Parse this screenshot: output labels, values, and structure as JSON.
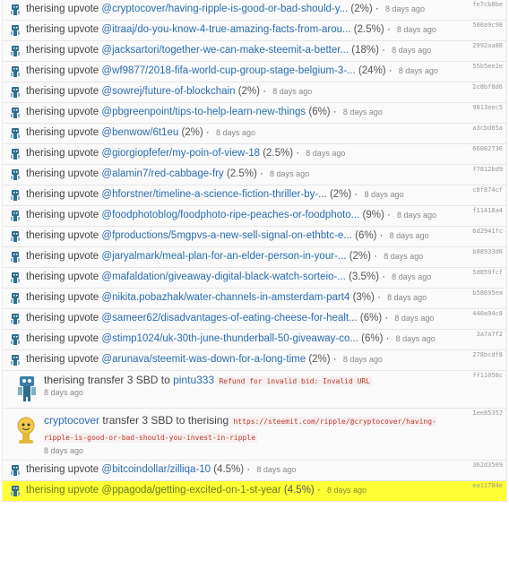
{
  "colors": {
    "link": "#2a6db0",
    "highlight": "#ffff33",
    "memo": "#c0392b",
    "avatar": "#2e6f8e"
  },
  "rows": [
    {
      "kind": "upvote",
      "user": "therising",
      "action": "upvote",
      "link": "@cryptocover/having-ripple-is-good-or-bad-should-y...",
      "pct": "(2%)",
      "time": "8 days ago",
      "hash": "fe7cb8be"
    },
    {
      "kind": "upvote",
      "user": "therising",
      "action": "upvote",
      "link": "@itraaj/do-you-know-4-true-amazing-facts-from-arou...",
      "pct": "(2.5%)",
      "time": "8 days ago",
      "hash": "500a9c98"
    },
    {
      "kind": "upvote",
      "user": "therising",
      "action": "upvote",
      "link": "@jacksartori/together-we-can-make-steemit-a-better...",
      "pct": "(18%)",
      "time": "8 days ago",
      "hash": "2992aa80"
    },
    {
      "kind": "upvote",
      "user": "therising",
      "action": "upvote",
      "link": "@wf9877/2018-fifa-world-cup-group-stage-belgium-3-...",
      "pct": "(24%)",
      "time": "8 days ago",
      "hash": "55b5ee2e"
    },
    {
      "kind": "upvote",
      "user": "therising",
      "action": "upvote",
      "link": "@sowrej/future-of-blockchain",
      "pct": "(2%)",
      "time": "8 days ago",
      "hash": "2c8bf8d6"
    },
    {
      "kind": "upvote",
      "user": "therising",
      "action": "upvote",
      "link": "@pbgreenpoint/tips-to-help-learn-new-things",
      "pct": "(6%)",
      "time": "8 days ago",
      "hash": "9813eec5"
    },
    {
      "kind": "upvote",
      "user": "therising",
      "action": "upvote",
      "link": "@benwow/6t1eu",
      "pct": "(2%)",
      "time": "8 days ago",
      "hash": "a3cbd65a"
    },
    {
      "kind": "upvote",
      "user": "therising",
      "action": "upvote",
      "link": "@giorgiopfefer/my-poin-of-view-18",
      "pct": "(2.5%)",
      "time": "8 days ago",
      "hash": "66002736"
    },
    {
      "kind": "upvote",
      "user": "therising",
      "action": "upvote",
      "link": "@alamin7/red-cabbage-fry",
      "pct": "(2.5%)",
      "time": "8 days ago",
      "hash": "f7812bd9"
    },
    {
      "kind": "upvote",
      "user": "therising",
      "action": "upvote",
      "link": "@hforstner/timeline-a-science-fiction-thriller-by-...",
      "pct": "(2%)",
      "time": "8 days ago",
      "hash": "c8f874cf"
    },
    {
      "kind": "upvote",
      "user": "therising",
      "action": "upvote",
      "link": "@foodphotoblog/foodphoto-ripe-peaches-or-foodphoto...",
      "pct": "(9%)",
      "time": "8 days ago",
      "hash": "f11418a4"
    },
    {
      "kind": "upvote",
      "user": "therising",
      "action": "upvote",
      "link": "@fproductions/5mgpvs-a-new-sell-signal-on-ethbtc-e...",
      "pct": "(6%)",
      "time": "8 days ago",
      "hash": "6d2941fc"
    },
    {
      "kind": "upvote",
      "user": "therising",
      "action": "upvote",
      "link": "@jaryalmark/meal-plan-for-an-elder-person-in-your-...",
      "pct": "(2%)",
      "time": "8 days ago",
      "hash": "b88933d6"
    },
    {
      "kind": "upvote",
      "user": "therising",
      "action": "upvote",
      "link": "@mafaldation/giveaway-digital-black-watch-sorteio-...",
      "pct": "(3.5%)",
      "time": "8 days ago",
      "hash": "5d859fcf"
    },
    {
      "kind": "upvote",
      "user": "therising",
      "action": "upvote",
      "link": "@nikita.pobazhak/water-channels-in-amsterdam-part4",
      "pct": "(3%)",
      "time": "8 days ago",
      "hash": "b58695ea"
    },
    {
      "kind": "upvote",
      "user": "therising",
      "action": "upvote",
      "link": "@sameer62/disadvantages-of-eating-cheese-for-healt...",
      "pct": "(6%)",
      "time": "8 days ago",
      "hash": "440a94c8"
    },
    {
      "kind": "upvote",
      "user": "therising",
      "action": "upvote",
      "link": "@stimp1024/uk-30th-june-thunderball-50-giveaway-co...",
      "pct": "(6%)",
      "time": "8 days ago",
      "hash": "3a7a7f2"
    },
    {
      "kind": "upvote",
      "user": "therising",
      "action": "upvote",
      "link": "@arunava/steemit-was-down-for-a-long-time",
      "pct": "(2%)",
      "time": "8 days ago",
      "hash": "278bcdf8"
    },
    {
      "kind": "transfer1",
      "user": "therising",
      "action": "transfer 3 SBD to",
      "target": "pintu333",
      "memo": "Refund for invalid bid: Invalid URL",
      "time": "8 days ago",
      "hash": "ff11058c"
    },
    {
      "kind": "transfer2",
      "user": "cryptocover",
      "action": "transfer 3 SBD to",
      "target": "therising",
      "memo": "https://steemit.com/ripple/@cryptocover/having-ripple-is-good-or-bad-should-you-invest-in-ripple",
      "time": "8 days ago",
      "hash": "1ee85357"
    },
    {
      "kind": "upvote",
      "user": "therising",
      "action": "upvote",
      "link": "@bitcoindollar/zilliqa-10",
      "pct": "(4.5%)",
      "time": "8 days ago",
      "hash": "362d3509"
    },
    {
      "kind": "upvote",
      "highlight": true,
      "user": "therising",
      "action": "upvote",
      "link": "@ppagoda/getting-excited-on-1-st-year",
      "pct": "(4.5%)",
      "time": "8 days ago",
      "hash": "ea11704e"
    }
  ]
}
